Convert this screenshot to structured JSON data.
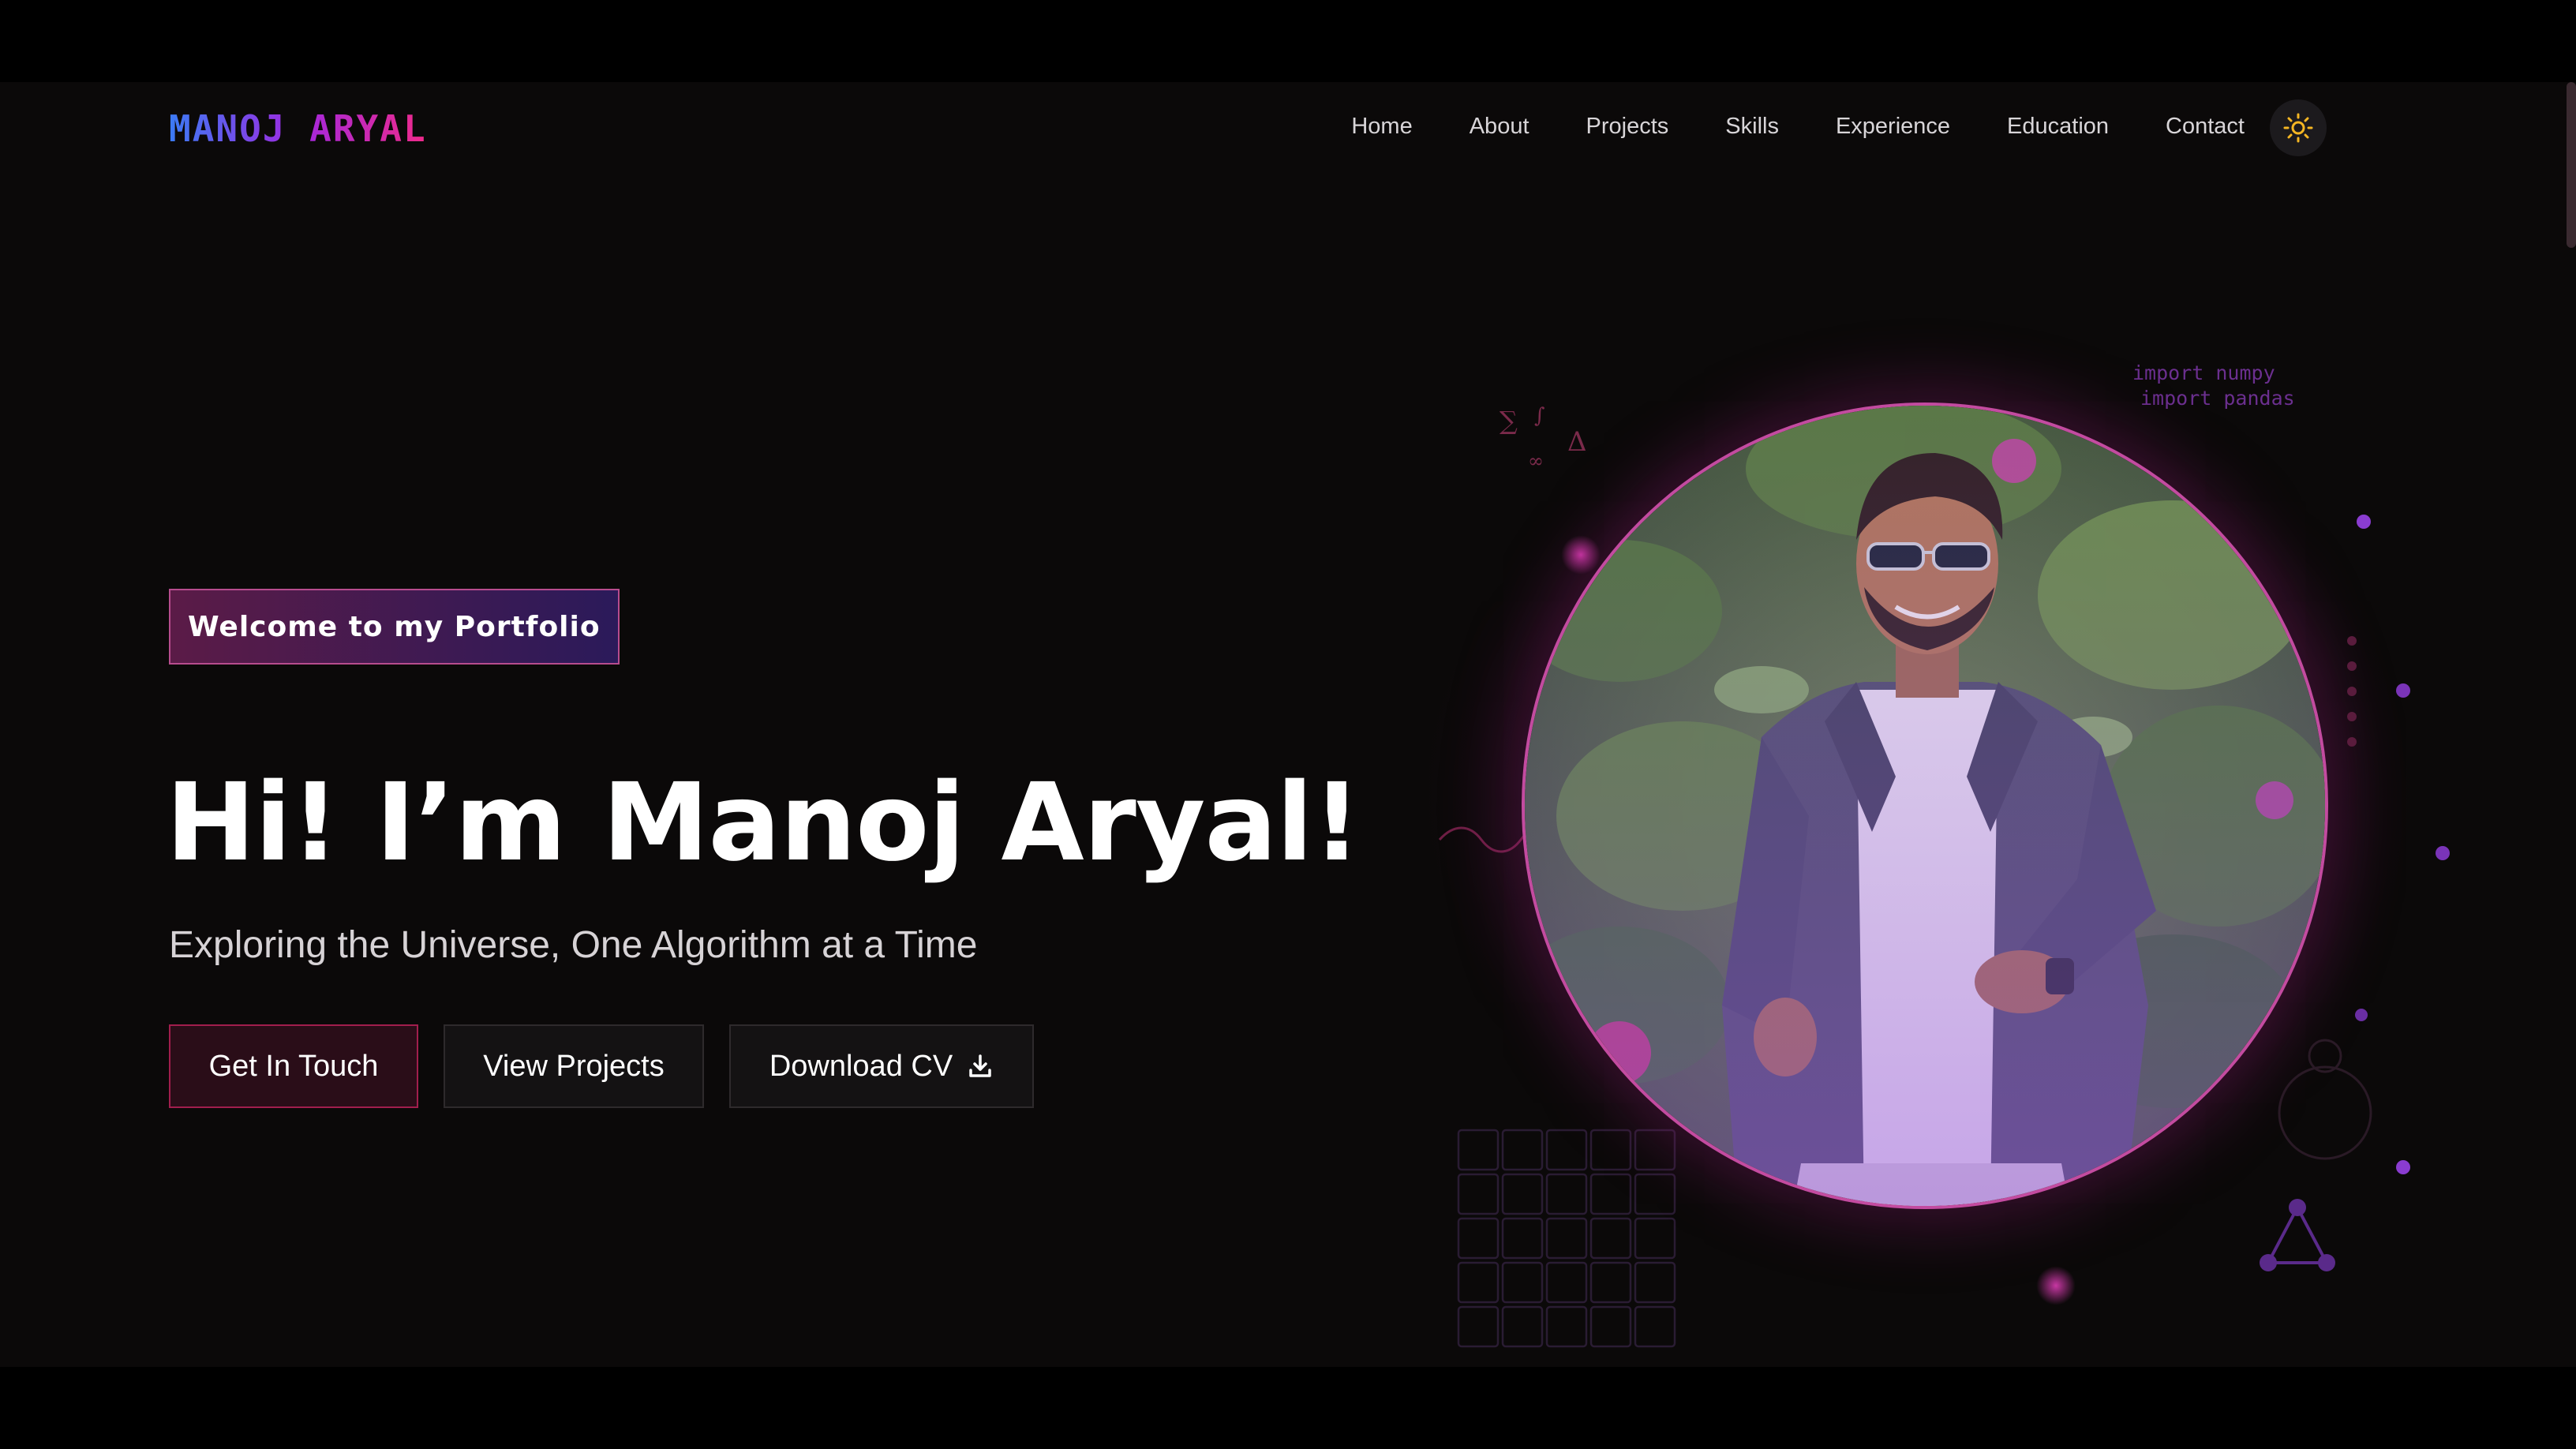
{
  "header": {
    "logo": "MANOJ ARYAL",
    "nav": [
      "Home",
      "About",
      "Projects",
      "Skills",
      "Experience",
      "Education",
      "Contact"
    ],
    "theme_icon": "sun-icon"
  },
  "hero": {
    "badge": "Welcome to my Portfolio",
    "title": "Hi! I’m Manoj Aryal!",
    "tagline": "Exploring the Universe, One Algorithm at a Time",
    "buttons": {
      "touch": "Get In Touch",
      "projects": "View Projects",
      "cv": "Download CV"
    },
    "code_lines": [
      "import numpy",
      "import pandas"
    ],
    "math_symbols": [
      "∑",
      "∫",
      "∞",
      "Δ"
    ]
  },
  "colors": {
    "accent_pink": "#c34ba0",
    "accent_purple": "#8a3cd0",
    "logo_gradient": [
      "#3b7bf5",
      "#a028e0",
      "#f02a8a"
    ]
  }
}
